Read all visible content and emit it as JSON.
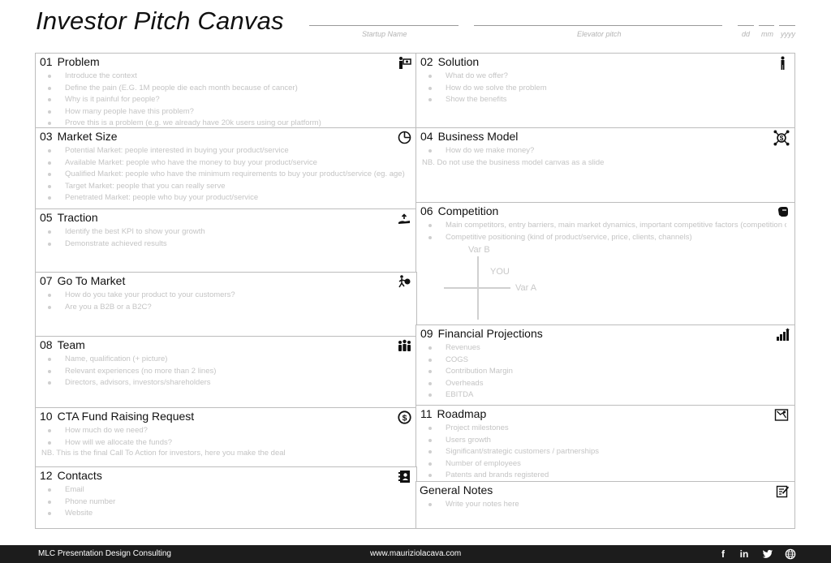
{
  "header": {
    "title": "Investor Pitch Canvas",
    "startup_label": "Startup Name",
    "elevator_label": "Elevator pitch",
    "dd": "dd",
    "mm": "mm",
    "yyyy": "yyyy"
  },
  "panels": {
    "problem": {
      "num": "01",
      "title": "Problem",
      "items": [
        "Introduce the context",
        "Define the pain (E.G. 1M people die each month because of cancer)",
        "Why is it painful for people?",
        "How many people have this problem?",
        "Prove this is a problem (e.g. we already have 20k users using our platform)"
      ]
    },
    "solution": {
      "num": "02",
      "title": "Solution",
      "items": [
        "What do we offer?",
        "How do we solve the problem",
        "Show the benefits"
      ]
    },
    "market": {
      "num": "03",
      "title": "Market Size",
      "items": [
        "Potential Market: people interested in buying your product/service",
        "Available Market: people who have the money to buy your product/service",
        "Qualified Market: people who have the minimum requirements to buy your product/service (eg. age)",
        "Target Market: people that you can really serve",
        "Penetrated Market: people who buy your product/service"
      ]
    },
    "business": {
      "num": "04",
      "title": "Business Model",
      "items": [
        "How do we make money?"
      ],
      "note": "NB. Do not use the business model canvas as a slide"
    },
    "traction": {
      "num": "05",
      "title": "Traction",
      "items": [
        "Identify the best KPI to show your growth",
        "Demonstrate achieved results"
      ]
    },
    "competition": {
      "num": "06",
      "title": "Competition",
      "items": [
        "Main competitors, entry barriers, main market dynamics, important competitive factors (competition chart)",
        "Competitive positioning (kind of product/service, price, clients, channels)"
      ],
      "var_b": "Var B",
      "var_a": "Var A",
      "you": "YOU"
    },
    "gotomarket": {
      "num": "07",
      "title": "Go To Market",
      "items": [
        "How do you take your product to your customers?",
        "Are you a B2B or a B2C?"
      ]
    },
    "team": {
      "num": "08",
      "title": "Team",
      "items": [
        "Name, qualification (+ picture)",
        "Relevant experiences (no more than 2 lines)",
        "Directors, advisors, investors/shareholders"
      ]
    },
    "financial": {
      "num": "09",
      "title": "Financial Projections",
      "items": [
        "Revenues",
        "COGS",
        "Contribution Margin",
        "Overheads",
        "EBITDA"
      ]
    },
    "cta": {
      "num": "10",
      "title": "CTA Fund Raising Request",
      "items": [
        "How much do we need?",
        "How will we allocate the funds?"
      ],
      "note": "NB. This is the final Call To Action for investors, here you make the deal"
    },
    "roadmap": {
      "num": "11",
      "title": "Roadmap",
      "items": [
        "Project milestones",
        "Users growth",
        "Significant/strategic customers / partnerships",
        "Number of employees",
        "Patents and brands registered"
      ]
    },
    "contacts": {
      "num": "12",
      "title": "Contacts",
      "items": [
        "Email",
        "Phone number",
        "Website"
      ]
    },
    "notes": {
      "title": "General Notes",
      "items": [
        "Write your notes here"
      ]
    }
  },
  "footer": {
    "company": "MLC Presentation Design Consulting",
    "website": "www.mauriziolacava.com",
    "facebook": "f",
    "linkedin": "in"
  }
}
